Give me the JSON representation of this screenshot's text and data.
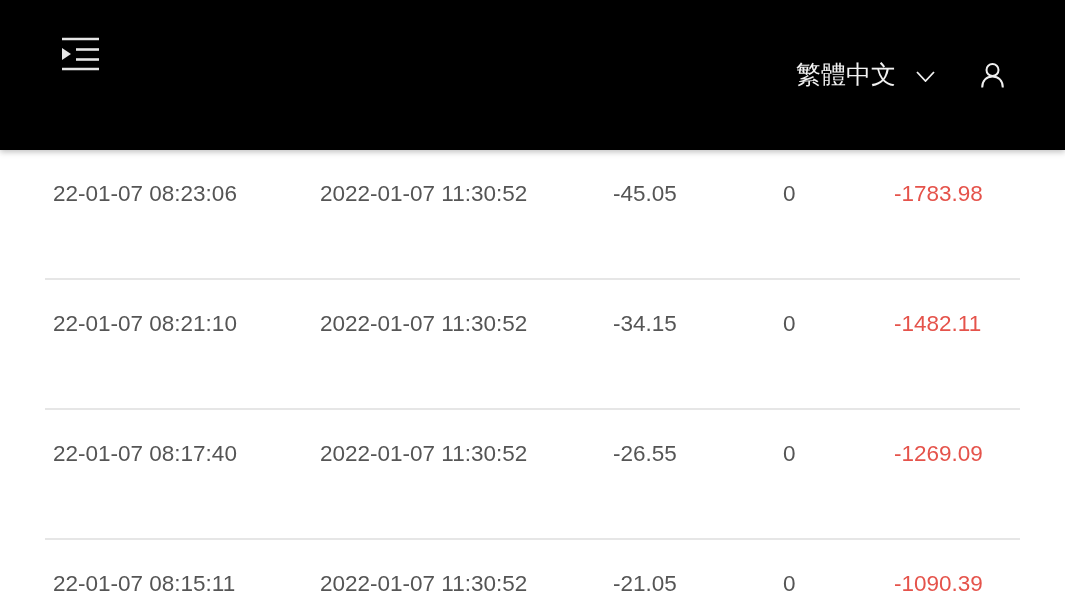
{
  "header": {
    "language": "繁體中文"
  },
  "rows": [
    {
      "column_1": "22-01-07 08:23:06",
      "column_2": "2022-01-07 11:30:52",
      "column_3": "-45.05",
      "column_4": "0",
      "column_5": "-1783.98"
    },
    {
      "column_1": "22-01-07 08:21:10",
      "column_2": "2022-01-07 11:30:52",
      "column_3": "-34.15",
      "column_4": "0",
      "column_5": "-1482.11"
    },
    {
      "column_1": "22-01-07 08:17:40",
      "column_2": "2022-01-07 11:30:52",
      "column_3": "-26.55",
      "column_4": "0",
      "column_5": "-1269.09"
    },
    {
      "column_1": "22-01-07 08:15:11",
      "column_2": "2022-01-07 11:30:52",
      "column_3": "-21.05",
      "column_4": "0",
      "column_5": "-1090.39"
    }
  ]
}
